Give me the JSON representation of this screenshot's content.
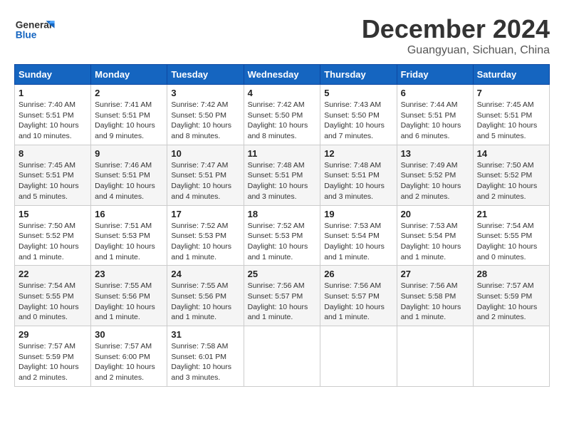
{
  "header": {
    "logo_line1": "General",
    "logo_line2": "Blue",
    "title": "December 2024",
    "subtitle": "Guangyuan, Sichuan, China"
  },
  "weekdays": [
    "Sunday",
    "Monday",
    "Tuesday",
    "Wednesday",
    "Thursday",
    "Friday",
    "Saturday"
  ],
  "weeks": [
    [
      {
        "day": "1",
        "info": "Sunrise: 7:40 AM\nSunset: 5:51 PM\nDaylight: 10 hours\nand 10 minutes."
      },
      {
        "day": "2",
        "info": "Sunrise: 7:41 AM\nSunset: 5:51 PM\nDaylight: 10 hours\nand 9 minutes."
      },
      {
        "day": "3",
        "info": "Sunrise: 7:42 AM\nSunset: 5:50 PM\nDaylight: 10 hours\nand 8 minutes."
      },
      {
        "day": "4",
        "info": "Sunrise: 7:42 AM\nSunset: 5:50 PM\nDaylight: 10 hours\nand 8 minutes."
      },
      {
        "day": "5",
        "info": "Sunrise: 7:43 AM\nSunset: 5:50 PM\nDaylight: 10 hours\nand 7 minutes."
      },
      {
        "day": "6",
        "info": "Sunrise: 7:44 AM\nSunset: 5:51 PM\nDaylight: 10 hours\nand 6 minutes."
      },
      {
        "day": "7",
        "info": "Sunrise: 7:45 AM\nSunset: 5:51 PM\nDaylight: 10 hours\nand 5 minutes."
      }
    ],
    [
      {
        "day": "8",
        "info": "Sunrise: 7:45 AM\nSunset: 5:51 PM\nDaylight: 10 hours\nand 5 minutes."
      },
      {
        "day": "9",
        "info": "Sunrise: 7:46 AM\nSunset: 5:51 PM\nDaylight: 10 hours\nand 4 minutes."
      },
      {
        "day": "10",
        "info": "Sunrise: 7:47 AM\nSunset: 5:51 PM\nDaylight: 10 hours\nand 4 minutes."
      },
      {
        "day": "11",
        "info": "Sunrise: 7:48 AM\nSunset: 5:51 PM\nDaylight: 10 hours\nand 3 minutes."
      },
      {
        "day": "12",
        "info": "Sunrise: 7:48 AM\nSunset: 5:51 PM\nDaylight: 10 hours\nand 3 minutes."
      },
      {
        "day": "13",
        "info": "Sunrise: 7:49 AM\nSunset: 5:52 PM\nDaylight: 10 hours\nand 2 minutes."
      },
      {
        "day": "14",
        "info": "Sunrise: 7:50 AM\nSunset: 5:52 PM\nDaylight: 10 hours\nand 2 minutes."
      }
    ],
    [
      {
        "day": "15",
        "info": "Sunrise: 7:50 AM\nSunset: 5:52 PM\nDaylight: 10 hours\nand 1 minute."
      },
      {
        "day": "16",
        "info": "Sunrise: 7:51 AM\nSunset: 5:53 PM\nDaylight: 10 hours\nand 1 minute."
      },
      {
        "day": "17",
        "info": "Sunrise: 7:52 AM\nSunset: 5:53 PM\nDaylight: 10 hours\nand 1 minute."
      },
      {
        "day": "18",
        "info": "Sunrise: 7:52 AM\nSunset: 5:53 PM\nDaylight: 10 hours\nand 1 minute."
      },
      {
        "day": "19",
        "info": "Sunrise: 7:53 AM\nSunset: 5:54 PM\nDaylight: 10 hours\nand 1 minute."
      },
      {
        "day": "20",
        "info": "Sunrise: 7:53 AM\nSunset: 5:54 PM\nDaylight: 10 hours\nand 1 minute."
      },
      {
        "day": "21",
        "info": "Sunrise: 7:54 AM\nSunset: 5:55 PM\nDaylight: 10 hours\nand 0 minutes."
      }
    ],
    [
      {
        "day": "22",
        "info": "Sunrise: 7:54 AM\nSunset: 5:55 PM\nDaylight: 10 hours\nand 0 minutes."
      },
      {
        "day": "23",
        "info": "Sunrise: 7:55 AM\nSunset: 5:56 PM\nDaylight: 10 hours\nand 1 minute."
      },
      {
        "day": "24",
        "info": "Sunrise: 7:55 AM\nSunset: 5:56 PM\nDaylight: 10 hours\nand 1 minute."
      },
      {
        "day": "25",
        "info": "Sunrise: 7:56 AM\nSunset: 5:57 PM\nDaylight: 10 hours\nand 1 minute."
      },
      {
        "day": "26",
        "info": "Sunrise: 7:56 AM\nSunset: 5:57 PM\nDaylight: 10 hours\nand 1 minute."
      },
      {
        "day": "27",
        "info": "Sunrise: 7:56 AM\nSunset: 5:58 PM\nDaylight: 10 hours\nand 1 minute."
      },
      {
        "day": "28",
        "info": "Sunrise: 7:57 AM\nSunset: 5:59 PM\nDaylight: 10 hours\nand 2 minutes."
      }
    ],
    [
      {
        "day": "29",
        "info": "Sunrise: 7:57 AM\nSunset: 5:59 PM\nDaylight: 10 hours\nand 2 minutes."
      },
      {
        "day": "30",
        "info": "Sunrise: 7:57 AM\nSunset: 6:00 PM\nDaylight: 10 hours\nand 2 minutes."
      },
      {
        "day": "31",
        "info": "Sunrise: 7:58 AM\nSunset: 6:01 PM\nDaylight: 10 hours\nand 3 minutes."
      },
      null,
      null,
      null,
      null
    ]
  ]
}
